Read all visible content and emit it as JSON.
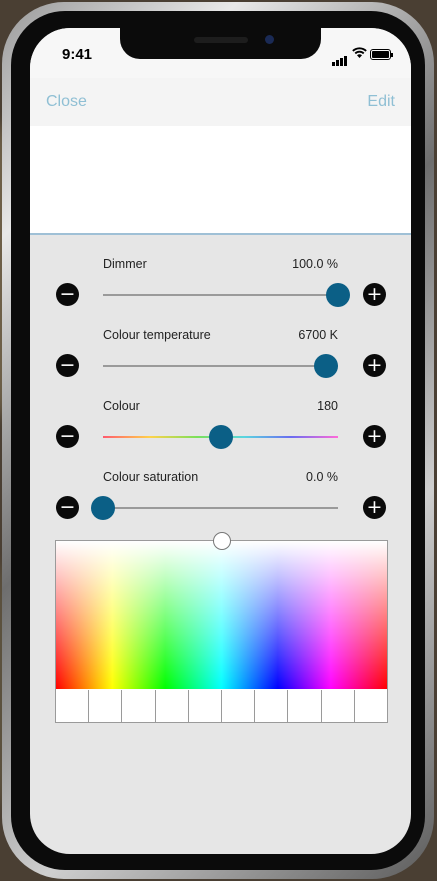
{
  "status": {
    "time": "9:41"
  },
  "nav": {
    "close_label": "Close",
    "edit_label": "Edit"
  },
  "controls": [
    {
      "label": "Dimmer",
      "value": "100.0 %",
      "level": 1.0
    },
    {
      "label": "Colour temperature",
      "value": "6700 K",
      "level": 0.95
    },
    {
      "label": "Colour",
      "value": "180",
      "level": 0.5
    },
    {
      "label": "Colour saturation",
      "value": "0.0 %",
      "level": 0.0
    }
  ],
  "icons": {
    "minus": "−",
    "plus": "+"
  },
  "picker": {
    "cursor_hue_fraction": 0.5,
    "cursor_saturation": 0.0,
    "swatch_count": 10
  },
  "colors": {
    "accent": "#8fbfd4",
    "thumb": "#0b5f86",
    "background": "#e6e6e6"
  }
}
